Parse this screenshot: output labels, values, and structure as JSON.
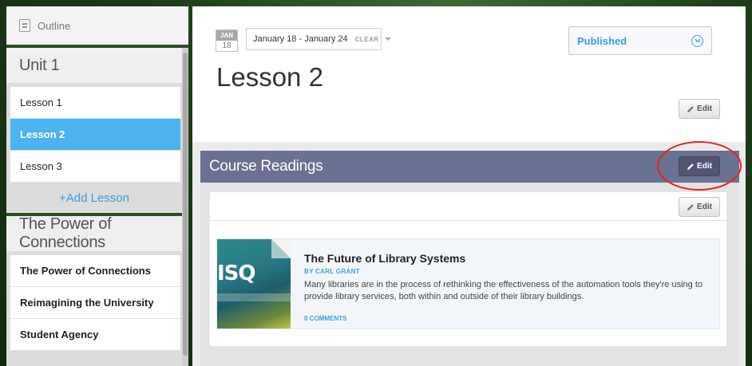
{
  "sidebar": {
    "outline_label": "Outline",
    "units": [
      {
        "title": "Unit 1",
        "lessons": [
          "Lesson 1",
          "Lesson 2",
          "Lesson 3"
        ],
        "add_label": "+Add Lesson"
      },
      {
        "title": "The Power of Connections",
        "lessons": [
          "The Power of Connections",
          "Reimagining the University",
          "Student Agency"
        ]
      }
    ]
  },
  "header": {
    "calendar_month": "JAN",
    "calendar_day": "18",
    "date_range": "January 18 - January 24",
    "clear_label": "CLEAR",
    "status": "Published",
    "lesson_title": "Lesson 2",
    "edit_label": "Edit"
  },
  "readings": {
    "title": "Course Readings",
    "edit_label": "Edit",
    "inner_edit_label": "Edit",
    "items": [
      {
        "title": "The Future of Library Systems",
        "author": "BY CARL GRANT",
        "description": "Many libraries are in the process of rethinking the effectiveness of the automation tools they're using to provide library services, both within and outside of their library buildings.",
        "comments": "0 COMMENTS",
        "cover_text": "ISQ"
      }
    ]
  },
  "colors": {
    "accent": "#3c9de0",
    "active_lesson": "#4ab3f0",
    "readings_bar": "#6b7192",
    "highlight": "#e0261f"
  }
}
